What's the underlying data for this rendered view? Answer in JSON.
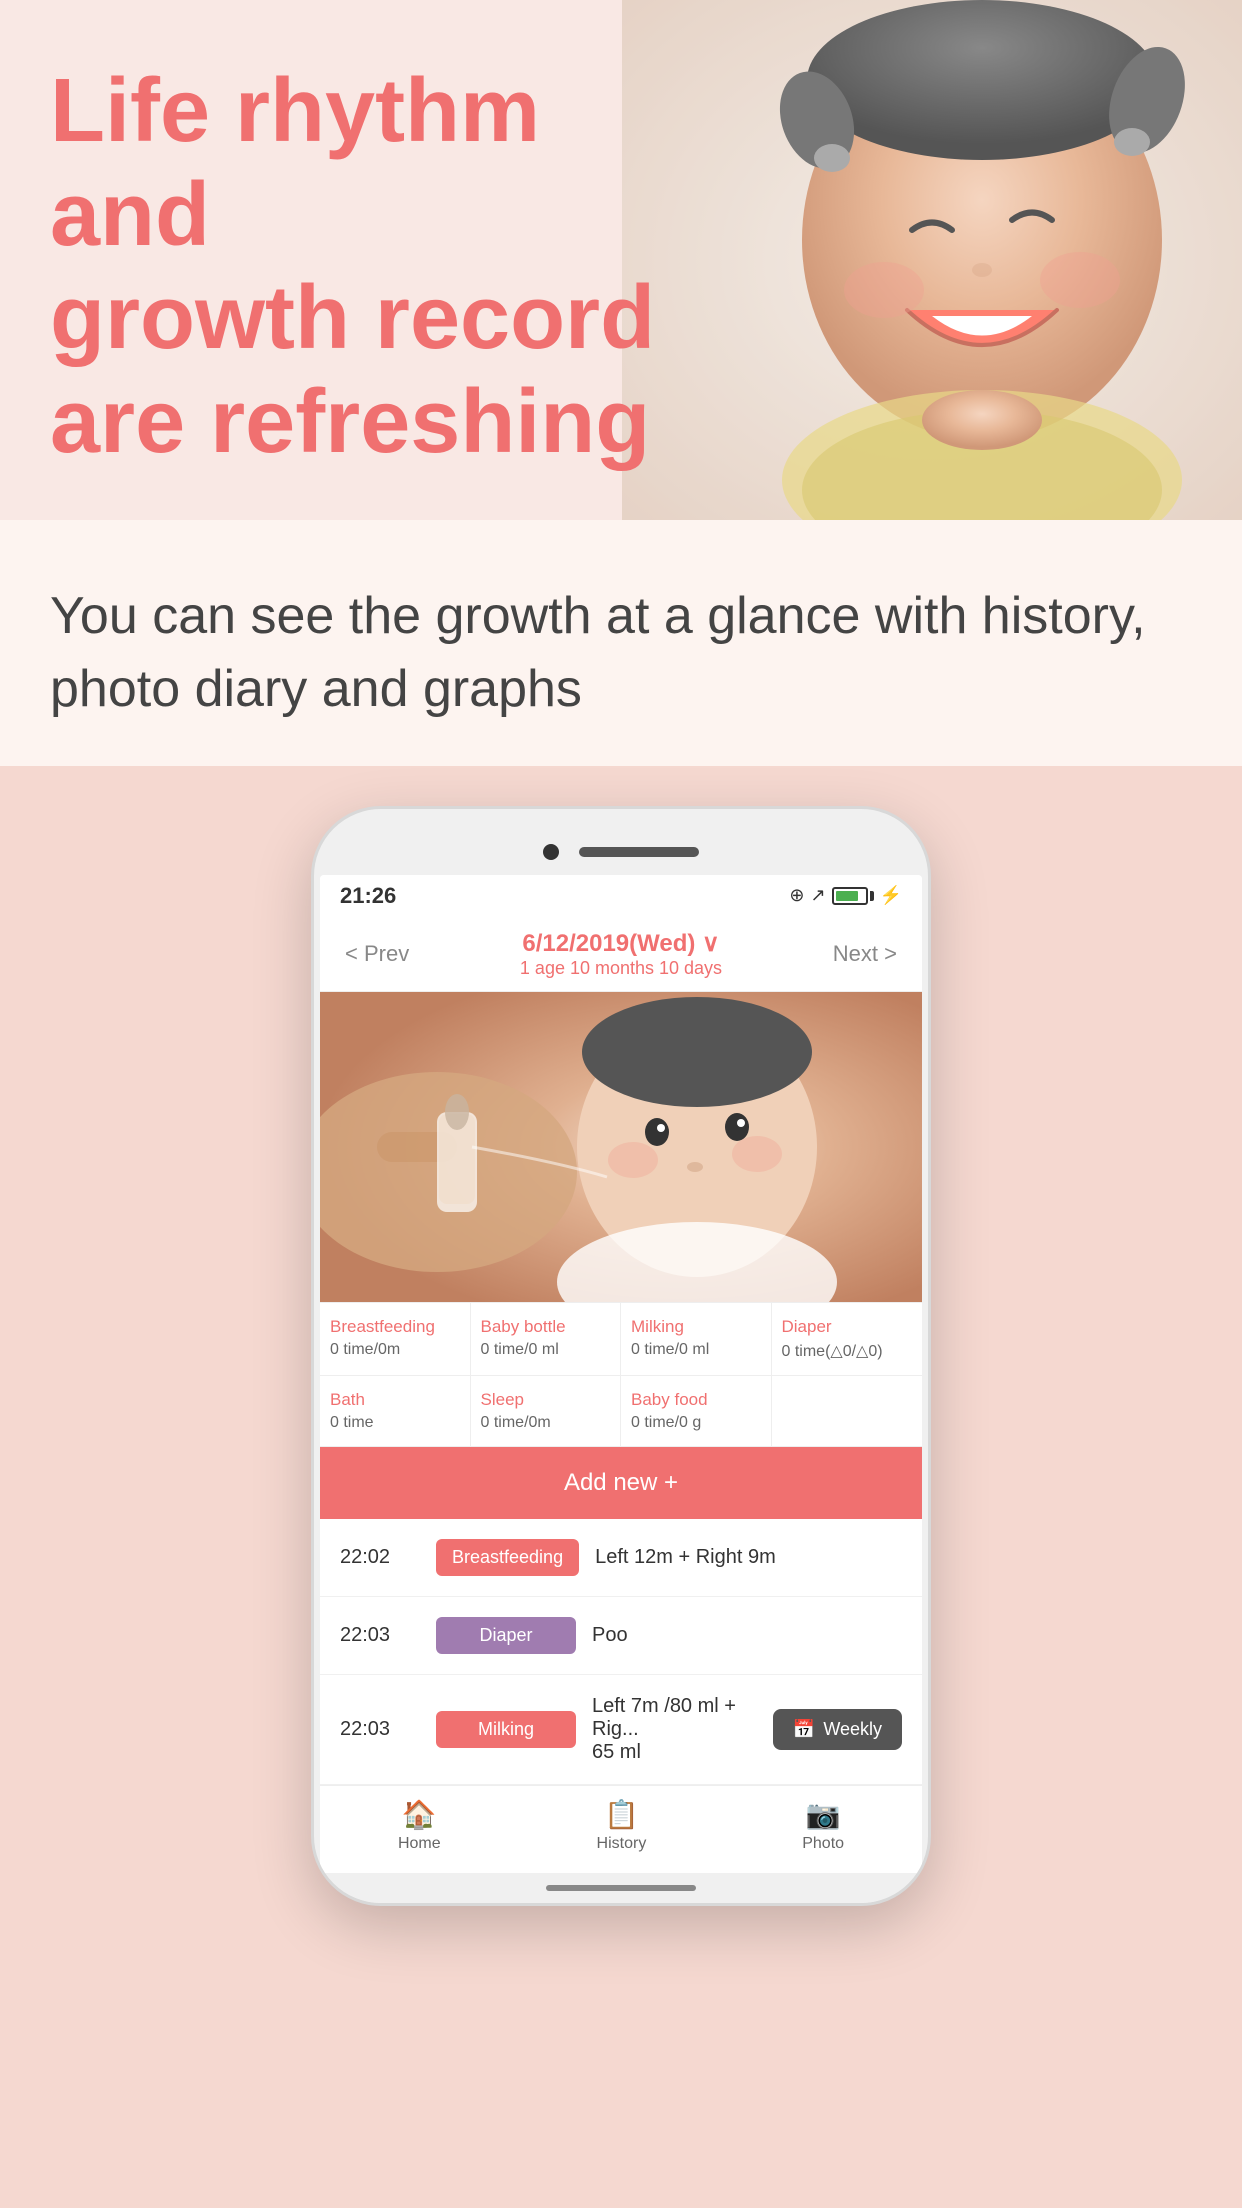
{
  "hero": {
    "title_line1": "Life rhythm",
    "title_line2": "and",
    "title_line3": "growth record",
    "title_line4": "are refreshing"
  },
  "subtitle": {
    "text": "You can see the growth at a glance with history, photo diary and graphs"
  },
  "phone": {
    "status_bar": {
      "time": "21:26",
      "icons": "⊕ ↗"
    },
    "nav": {
      "prev": "< Prev",
      "date": "6/12/2019(Wed) ∨",
      "age": "1 age 10 months 10 days",
      "next": "Next >"
    },
    "stats_row1": [
      {
        "label": "Breastfeeding",
        "value": "0 time/0m"
      },
      {
        "label": "Baby bottle",
        "value": "0 time/0 ml"
      },
      {
        "label": "Milking",
        "value": "0 time/0 ml"
      },
      {
        "label": "Diaper",
        "value": "0 time(△0/△0)"
      }
    ],
    "stats_row2": [
      {
        "label": "Bath",
        "value": "0 time"
      },
      {
        "label": "Sleep",
        "value": "0 time/0m"
      },
      {
        "label": "Baby food",
        "value": "0 time/0 g"
      },
      {
        "label": "",
        "value": ""
      }
    ],
    "add_new_label": "Add new +",
    "activities": [
      {
        "time": "22:02",
        "badge": "Breastfeeding",
        "badge_class": "badge-breastfeeding",
        "desc": "Left 12m  + Right 9m"
      },
      {
        "time": "22:03",
        "badge": "Diaper",
        "badge_class": "badge-diaper",
        "desc": "Poo"
      },
      {
        "time": "22:03",
        "badge": "Milking",
        "badge_class": "badge-milking",
        "desc": "Left 7m /80 ml + Rig... 65 ml"
      }
    ],
    "weekly_button": "Weekly",
    "bottom_nav": [
      {
        "icon": "🏠",
        "label": "Home"
      },
      {
        "icon": "📋",
        "label": "History"
      },
      {
        "icon": "📷",
        "label": "Photo"
      }
    ]
  }
}
